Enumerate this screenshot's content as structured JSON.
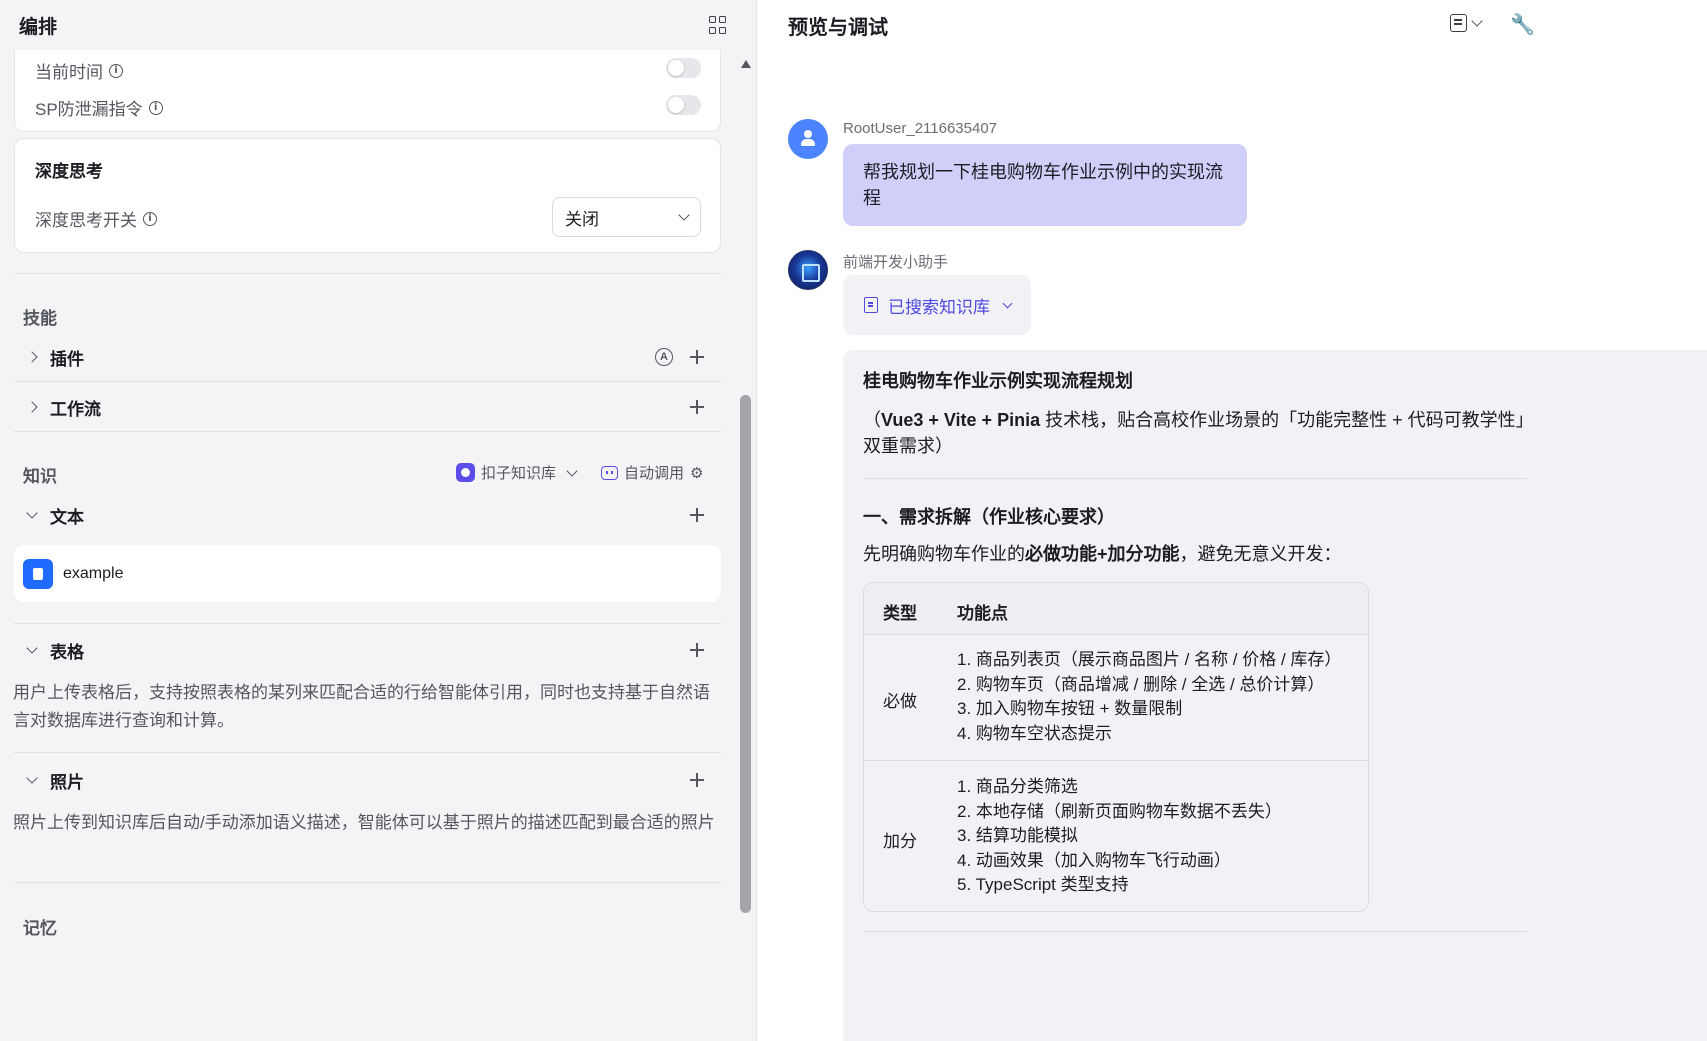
{
  "left": {
    "title": "编排",
    "prompt_rows": {
      "current_time": "当前时间",
      "sp_guard": "SP防泄漏指令"
    },
    "deep_thinking": {
      "title": "深度思考",
      "switch_label": "深度思考开关",
      "selected": "关闭"
    },
    "skills": {
      "label": "技能",
      "plugin": "插件",
      "workflow": "工作流"
    },
    "knowledge": {
      "label": "知识",
      "kb_source": "扣子知识库",
      "auto_call": "自动调用",
      "text_label": "文本",
      "doc_name": "example",
      "table_label": "表格",
      "table_desc": "用户上传表格后，支持按照表格的某列来匹配合适的行给智能体引用，同时也支持基于自然语言对数据库进行查询和计算。",
      "photo_label": "照片",
      "photo_desc": "照片上传到知识库后自动/手动添加语义描述，智能体可以基于照片的描述匹配到最合适的照片"
    },
    "memory": {
      "label": "记忆"
    }
  },
  "right": {
    "title": "预览与调试",
    "user": {
      "name": "RootUser_2116635407",
      "message": "帮我规划一下桂电购物车作业示例中的实现流程"
    },
    "bot": {
      "name": "前端开发小助手",
      "kb_chip": "已搜索知识库",
      "answer": {
        "title": "桂电购物车作业示例实现流程规划",
        "subtitle_prefix": "（",
        "subtitle_bold": "Vue3 + Vite + Pinia",
        "subtitle_rest": " 技术栈，贴合高校作业场景的「功能完整性 + 代码可教学性」双重需求）",
        "section1": "一、需求拆解（作业核心要求）",
        "intro_prefix": "先明确购物车作业的",
        "intro_bold1": "必做功能",
        "intro_plus": "+",
        "intro_bold2": "加分功能",
        "intro_rest": "，避免无意义开发：",
        "table": {
          "headers": [
            "类型",
            "功能点"
          ],
          "rows": [
            {
              "type": "必做",
              "items": [
                "1. 商品列表页（展示商品图片 / 名称 / 价格 / 库存）",
                "2. 购物车页（商品增减 / 删除 / 全选 / 总价计算）",
                "3. 加入购物车按钮 + 数量限制",
                "4. 购物车空状态提示"
              ]
            },
            {
              "type": "加分",
              "items": [
                "1. 商品分类筛选",
                "2. 本地存储（刷新页面购物车数据不丢失）",
                "3. 结算功能模拟",
                "4. 动画效果（加入购物车飞行动画）",
                "5. TypeScript 类型支持"
              ]
            }
          ]
        }
      }
    }
  },
  "icons": {
    "layout_toggle": "grid-icon",
    "info": "info-icon",
    "expand": "chevron-icon",
    "add": "plus-icon",
    "auto_mode": "circle-a-icon",
    "settings": "gear-icon",
    "document": "document-icon",
    "calendar": "calendar-icon",
    "debug": "wrench-icon",
    "knowledge": "book-icon"
  },
  "colors": {
    "accent": "#4d4ae0",
    "user_bubble": "#cfcffa",
    "user_avatar": "#4c84ff",
    "doc_icon": "#1f6bff"
  }
}
